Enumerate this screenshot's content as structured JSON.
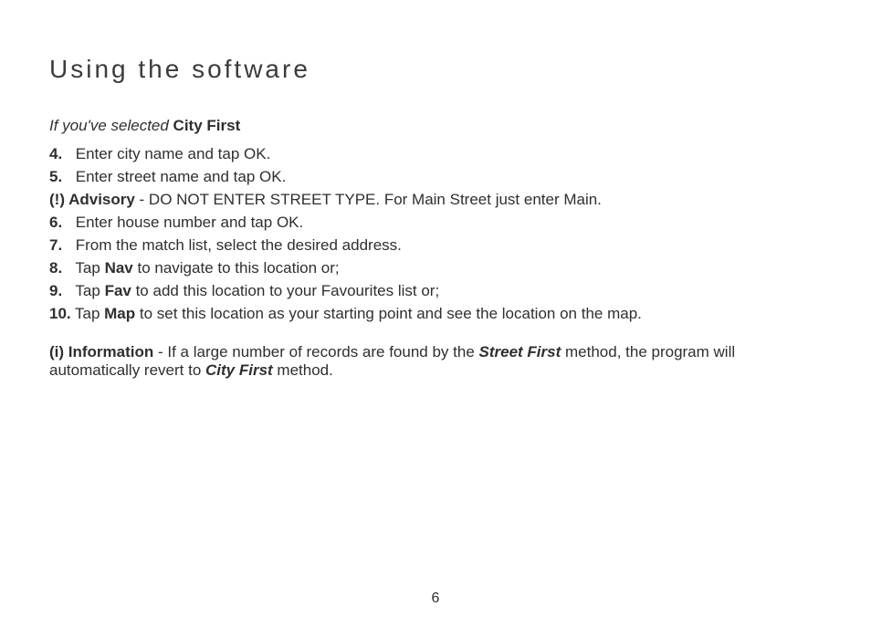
{
  "heading": "Using the software",
  "intro": {
    "prefix": "If you've selected ",
    "mode": "City First"
  },
  "steps": {
    "s4": {
      "num": "4.",
      "text": "Enter city name and tap OK."
    },
    "s5": {
      "num": "5.",
      "text": "Enter street name and tap OK."
    },
    "advisory": {
      "label": "(!) Advisory",
      "text": " - DO NOT ENTER STREET TYPE.  For Main Street just enter Main."
    },
    "s6": {
      "num": "6.",
      "text": "Enter house number and tap OK."
    },
    "s7": {
      "num": "7.",
      "text": "From the match list, select the desired address."
    },
    "s8": {
      "num": "8.",
      "pre": "Tap ",
      "bold": "Nav",
      "post": " to navigate to this location or;"
    },
    "s9": {
      "num": "9.",
      "pre": "Tap ",
      "bold": "Fav",
      "post": " to add this location to your Favourites list or;"
    },
    "s10": {
      "num": "10.",
      "pre": "Tap ",
      "bold": "Map",
      "post": " to set this location as your starting point and see the location on the map."
    }
  },
  "info": {
    "label": "(i) Information",
    "t1": " - If a large number of records are found by the ",
    "m1": "Street First",
    "t2": " method, the program will automatically revert to ",
    "m2": "City First",
    "t3": " method."
  },
  "pageNumber": "6"
}
